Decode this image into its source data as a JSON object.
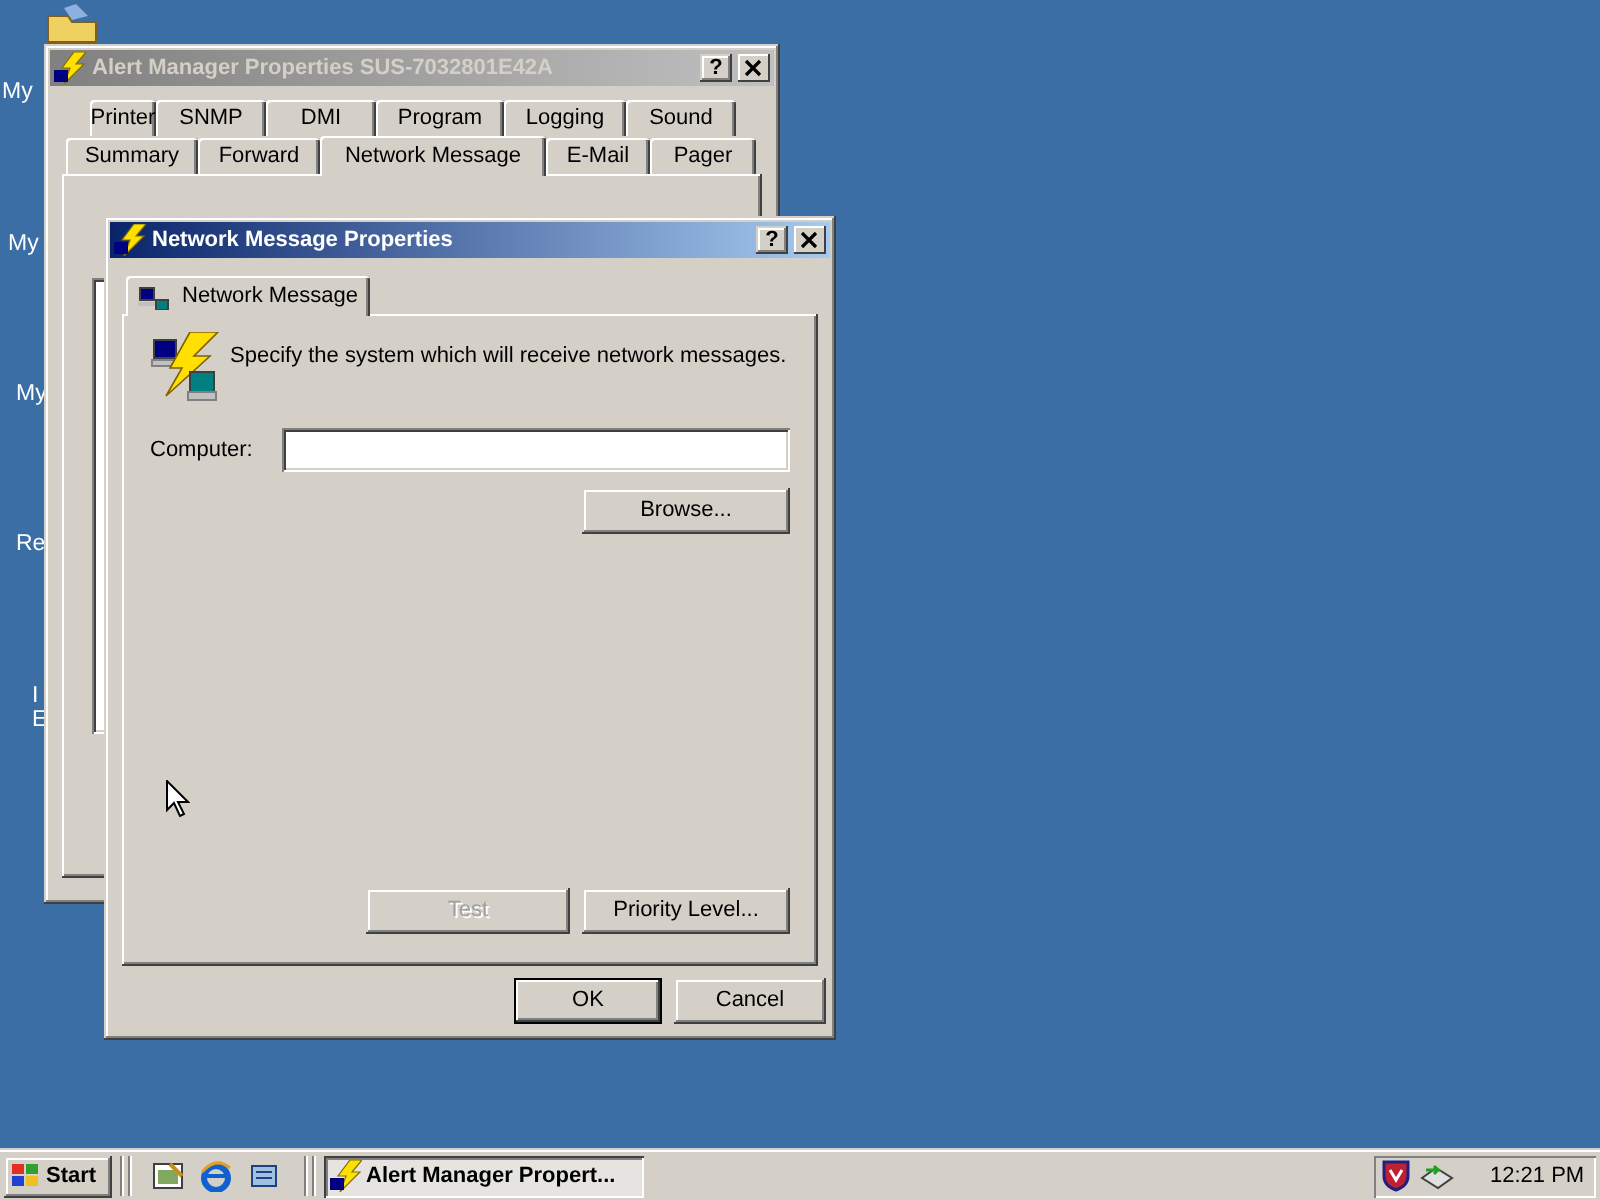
{
  "desktop_icons": [
    {
      "label": "My"
    },
    {
      "label": "My"
    },
    {
      "label": "My"
    },
    {
      "label": "Re"
    },
    {
      "label": "I"
    },
    {
      "label": "E"
    }
  ],
  "background_window": {
    "title": "Alert Manager Properties SUS-7032801E42A",
    "active": false,
    "help": "?",
    "tab_rows": [
      [
        {
          "label": "Printer",
          "selected": false
        },
        {
          "label": "SNMP",
          "selected": false
        },
        {
          "label": "DMI",
          "selected": false
        },
        {
          "label": "Program",
          "selected": false
        },
        {
          "label": "Logging",
          "selected": false
        },
        {
          "label": "Sound",
          "selected": false
        }
      ],
      [
        {
          "label": "Summary",
          "selected": false
        },
        {
          "label": "Forward",
          "selected": false
        },
        {
          "label": "Network Message",
          "selected": true
        },
        {
          "label": "E-Mail",
          "selected": false
        },
        {
          "label": "Pager",
          "selected": false
        }
      ]
    ]
  },
  "dialog": {
    "title": "Network Message Properties",
    "active": true,
    "help": "?",
    "tabs": [
      {
        "label": "Network Message",
        "selected": true
      }
    ],
    "instruction": "Specify the system which will receive network messages.",
    "computer_label": "Computer:",
    "browse_button": {
      "label": "Browse...",
      "disabled": false
    },
    "action_buttons": [
      {
        "label": "Test",
        "disabled": true
      },
      {
        "label": "Priority Level...",
        "disabled": false
      }
    ],
    "footer_buttons": [
      {
        "label": "OK",
        "default": true
      },
      {
        "label": "Cancel",
        "default": false
      }
    ]
  },
  "taskbar": {
    "start": "Start",
    "tasks": [
      {
        "label": "Alert Manager Propert...",
        "selected": true
      }
    ],
    "clock": "12:21 PM"
  }
}
